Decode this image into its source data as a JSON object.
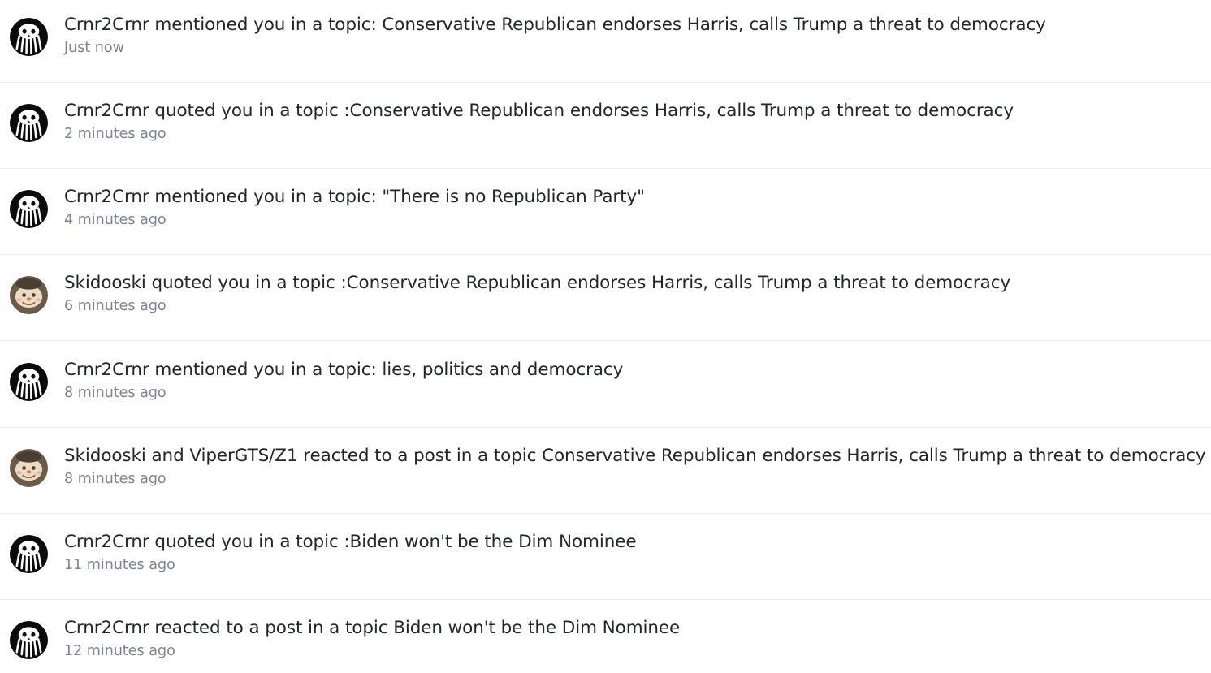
{
  "notifications": [
    {
      "avatar": "octopus-avatar",
      "text": "Crnr2Crnr mentioned you in a topic: Conservative Republican endorses Harris, calls Trump a threat to democracy",
      "time": "Just now"
    },
    {
      "avatar": "octopus-avatar",
      "text": "Crnr2Crnr quoted you in a topic :Conservative Republican endorses Harris, calls Trump a threat to democracy",
      "time": "2 minutes ago"
    },
    {
      "avatar": "octopus-avatar",
      "text": "Crnr2Crnr mentioned you in a topic: \"There is no Republican Party\"",
      "time": "4 minutes ago"
    },
    {
      "avatar": "photo-avatar",
      "text": "Skidooski quoted you in a topic :Conservative Republican endorses Harris, calls Trump a threat to democracy",
      "time": "6 minutes ago"
    },
    {
      "avatar": "octopus-avatar",
      "text": "Crnr2Crnr mentioned you in a topic: lies, politics and democracy",
      "time": "8 minutes ago"
    },
    {
      "avatar": "photo-avatar",
      "text": "Skidooski and ViperGTS/Z1 reacted to a post in a topic Conservative Republican endorses Harris, calls Trump a threat to democracy",
      "time": "8 minutes ago"
    },
    {
      "avatar": "octopus-avatar",
      "text": "Crnr2Crnr quoted you in a topic :Biden won't be the Dim Nominee",
      "time": "11 minutes ago"
    },
    {
      "avatar": "octopus-avatar",
      "text": "Crnr2Crnr reacted to a post in a topic Biden won't be the Dim Nominee",
      "time": "12 minutes ago"
    }
  ]
}
